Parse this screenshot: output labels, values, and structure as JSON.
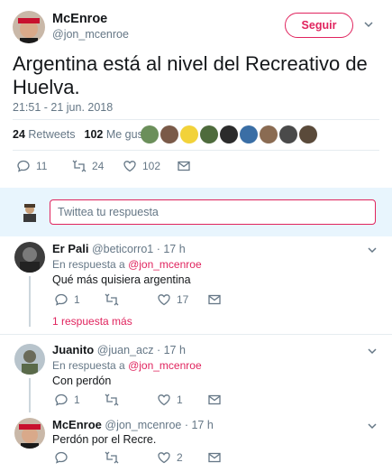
{
  "main_tweet": {
    "name": "McEnroe",
    "handle": "@jon_mcenroe",
    "follow_label": "Seguir",
    "text": "Argentina está al nivel del Recreativo de Huelva.",
    "timestamp": "21:51 - 21 jun. 2018",
    "retweets_count": "24",
    "retweets_label": "Retweets",
    "likes_count": "102",
    "likes_label": "Me gusta",
    "actions": {
      "replies": "11",
      "retweets": "24",
      "likes": "102"
    }
  },
  "reply_box": {
    "placeholder": "Twittea tu respuesta"
  },
  "replies": [
    {
      "name": "Er Pali",
      "handle": "@beticorro1",
      "time": "· 17 h",
      "in_reply_prefix": "En respuesta a",
      "in_reply_to": "@jon_mcenroe",
      "text": "Qué más quisiera argentina",
      "actions": {
        "replies": "1",
        "retweets": "",
        "likes": "17"
      },
      "more_replies": "1 respuesta más"
    },
    {
      "name": "Juanito",
      "handle": "@juan_acz",
      "time": "· 17 h",
      "in_reply_prefix": "En respuesta a",
      "in_reply_to": "@jon_mcenroe",
      "text": "Con perdón",
      "actions": {
        "replies": "1",
        "retweets": "",
        "likes": "1"
      }
    },
    {
      "name": "McEnroe",
      "handle": "@jon_mcenroe",
      "time": "· 17 h",
      "text": "Perdón por el Recre.",
      "actions": {
        "replies": "",
        "retweets": "",
        "likes": "2"
      }
    }
  ],
  "colors": {
    "accent": "#e0245e",
    "muted": "#657786",
    "divider": "#e6ecf0",
    "reply_bg": "#e8f5fd"
  }
}
